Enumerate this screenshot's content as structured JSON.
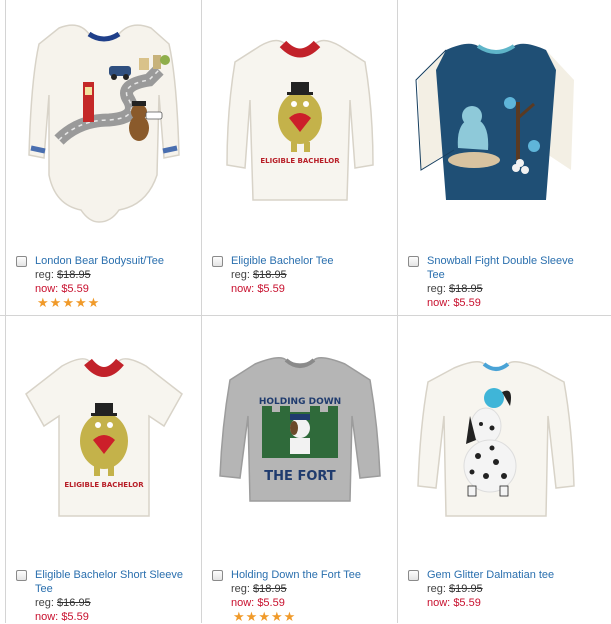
{
  "colors": {
    "link": "#2a6fae",
    "sale": "#c8102e",
    "star": "#f09a2a",
    "grid": "#d4d4d4"
  },
  "products": [
    {
      "name": "London Bear Bodysuit/Tee",
      "reg_label": "reg:",
      "reg_price": "$18.95",
      "now_label": "now:",
      "now_price": "$5.59",
      "rating": 5,
      "image": "london-bear-bodysuit-image"
    },
    {
      "name": "Eligible Bachelor Tee",
      "reg_label": "reg:",
      "reg_price": "$18.95",
      "now_label": "now:",
      "now_price": "$5.59",
      "rating": 0,
      "image": "eligible-bachelor-tee-image",
      "graphic_text": "ELIGIBLE BACHELOR"
    },
    {
      "name": "Snowball Fight Double Sleeve Tee",
      "reg_label": "reg:",
      "reg_price": "$18.95",
      "now_label": "now:",
      "now_price": "$5.59",
      "rating": 0,
      "image": "snowball-fight-tee-image"
    },
    {
      "name": "Eligible Bachelor Short Sleeve Tee",
      "reg_label": "reg:",
      "reg_price": "$16.95",
      "now_label": "now:",
      "now_price": "$5.59",
      "rating": 0,
      "image": "eligible-bachelor-short-sleeve-image",
      "graphic_text": "ELIGIBLE BACHELOR"
    },
    {
      "name": "Holding Down the Fort Tee",
      "reg_label": "reg:",
      "reg_price": "$18.95",
      "now_label": "now:",
      "now_price": "$5.59",
      "rating": 5,
      "image": "holding-down-the-fort-image",
      "graphic_text_top": "HOLDING DOWN",
      "graphic_text_bottom": "THE FORT"
    },
    {
      "name": "Gem Glitter Dalmatian tee",
      "reg_label": "reg:",
      "reg_price": "$19.95",
      "now_label": "now:",
      "now_price": "$5.59",
      "rating": 0,
      "image": "gem-glitter-dalmatian-image"
    }
  ]
}
